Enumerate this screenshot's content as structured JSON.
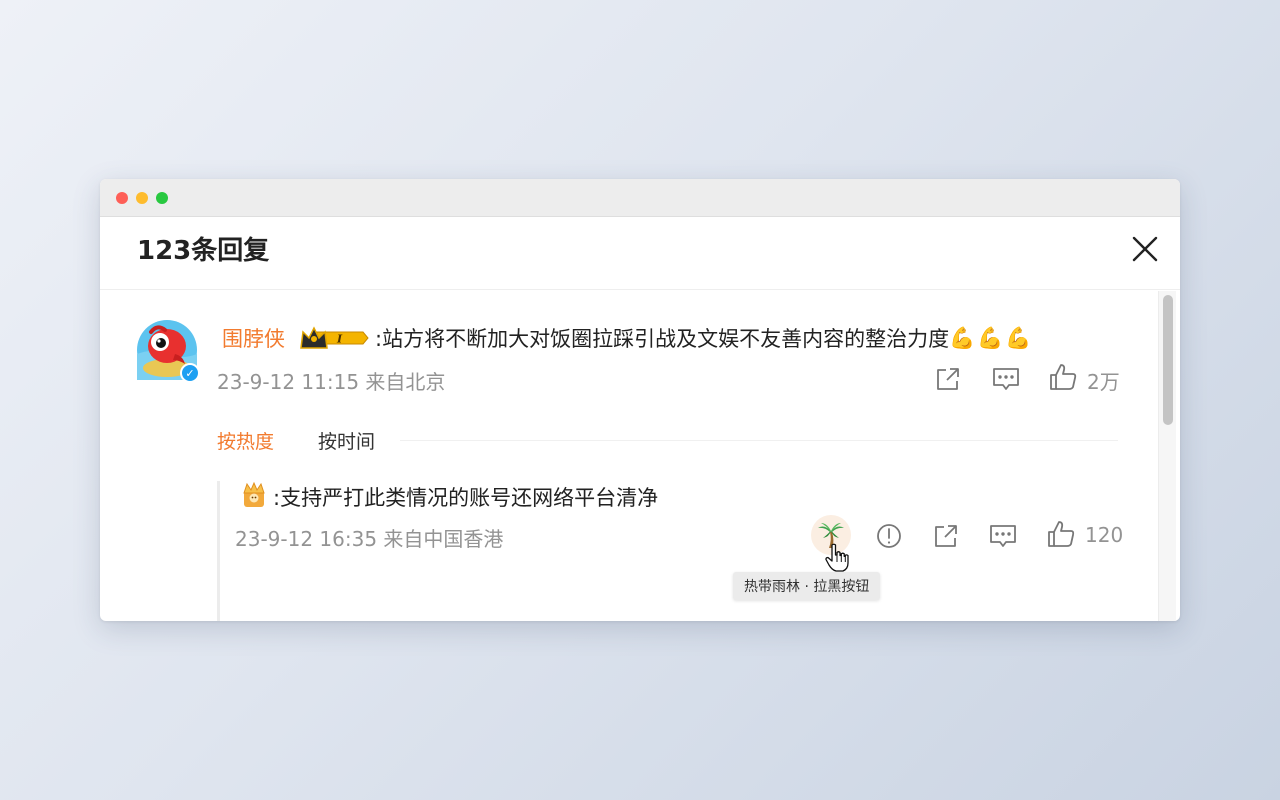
{
  "header": {
    "title": "123条回复"
  },
  "comment": {
    "username": "围脖侠",
    "text": ":站方将不断加大对饭圈拉踩引战及文娱不友善内容的整治力度",
    "emoji": "💪💪💪",
    "time_location": "23-9-12 11:15 来自北京",
    "like_count": "2万"
  },
  "sort_tabs": {
    "hot": "按热度",
    "time": "按时间"
  },
  "reply": {
    "text": ":支持严打此类情况的账号还网络平台清净",
    "time_location": "23-9-12 16:35 来自中国香港",
    "like_count": "120"
  },
  "tooltip": {
    "text": "热带雨林 · 拉黑按钮"
  },
  "icons": {
    "close": "close-icon",
    "share": "share-icon",
    "comment": "comment-icon",
    "like": "thumbs-up-icon",
    "report": "report-icon",
    "tree": "palm-tree-icon",
    "crown": "crown-icon",
    "medal": "crown-medal-icon",
    "cursor": "hand-cursor-icon"
  },
  "colors": {
    "accent": "#f27b2f",
    "meta": "#939393",
    "verified": "#1da0f2"
  }
}
